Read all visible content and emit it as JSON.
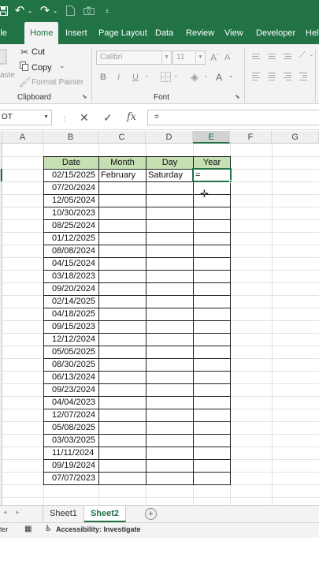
{
  "titlebar": {
    "icons": [
      "save-icon",
      "undo-icon",
      "undo-dropdown-icon",
      "redo-icon",
      "redo-dropdown-icon",
      "new-file-icon",
      "camera-icon",
      "customize-icon"
    ]
  },
  "tabs": [
    {
      "label": "ile"
    },
    {
      "label": "Home"
    },
    {
      "label": "Insert"
    },
    {
      "label": "Page Layout"
    },
    {
      "label": "Data"
    },
    {
      "label": "Review"
    },
    {
      "label": "View"
    },
    {
      "label": "Developer"
    },
    {
      "label": "Hel"
    }
  ],
  "ribbon": {
    "clipboard": {
      "paste_label": "aste",
      "cut_label": "Cut",
      "copy_label": "Copy",
      "format_painter_label": "Format Painter",
      "group_label": "Clipboard"
    },
    "font": {
      "font_name": "Calibri",
      "font_size": "11",
      "group_label": "Font"
    }
  },
  "formula_bar": {
    "name_box": "OT",
    "fx_label": "fx",
    "formula": "="
  },
  "columns": [
    "A",
    "B",
    "C",
    "D",
    "E",
    "F",
    "G"
  ],
  "table": {
    "headers": [
      "Date",
      "Month",
      "Day",
      "Year"
    ],
    "rows": [
      [
        "02/15/2025",
        "February",
        "Saturday",
        "="
      ],
      [
        "07/20/2024",
        "",
        "",
        ""
      ],
      [
        "12/05/2024",
        "",
        "",
        ""
      ],
      [
        "10/30/2023",
        "",
        "",
        ""
      ],
      [
        "08/25/2024",
        "",
        "",
        ""
      ],
      [
        "01/12/2025",
        "",
        "",
        ""
      ],
      [
        "08/08/2024",
        "",
        "",
        ""
      ],
      [
        "04/15/2024",
        "",
        "",
        ""
      ],
      [
        "03/18/2023",
        "",
        "",
        ""
      ],
      [
        "09/20/2024",
        "",
        "",
        ""
      ],
      [
        "02/14/2025",
        "",
        "",
        ""
      ],
      [
        "04/18/2025",
        "",
        "",
        ""
      ],
      [
        "09/15/2023",
        "",
        "",
        ""
      ],
      [
        "12/12/2024",
        "",
        "",
        ""
      ],
      [
        "05/05/2025",
        "",
        "",
        ""
      ],
      [
        "08/30/2025",
        "",
        "",
        ""
      ],
      [
        "06/13/2024",
        "",
        "",
        ""
      ],
      [
        "09/23/2024",
        "",
        "",
        ""
      ],
      [
        "04/04/2023",
        "",
        "",
        ""
      ],
      [
        "12/07/2024",
        "",
        "",
        ""
      ],
      [
        "05/08/2025",
        "",
        "",
        ""
      ],
      [
        "03/03/2025",
        "",
        "",
        ""
      ],
      [
        "11/11/2024",
        "",
        "",
        ""
      ],
      [
        "09/19/2024",
        "",
        "",
        ""
      ],
      [
        "07/07/2023",
        "",
        "",
        ""
      ]
    ]
  },
  "sheets": [
    {
      "label": "Sheet1",
      "active": false
    },
    {
      "label": "Sheet2",
      "active": true
    }
  ],
  "status": {
    "mode": "ter",
    "accessibility": "Accessibility: Investigate"
  },
  "colors": {
    "excel_green": "#217346",
    "header_fill": "#c6e0b4"
  }
}
